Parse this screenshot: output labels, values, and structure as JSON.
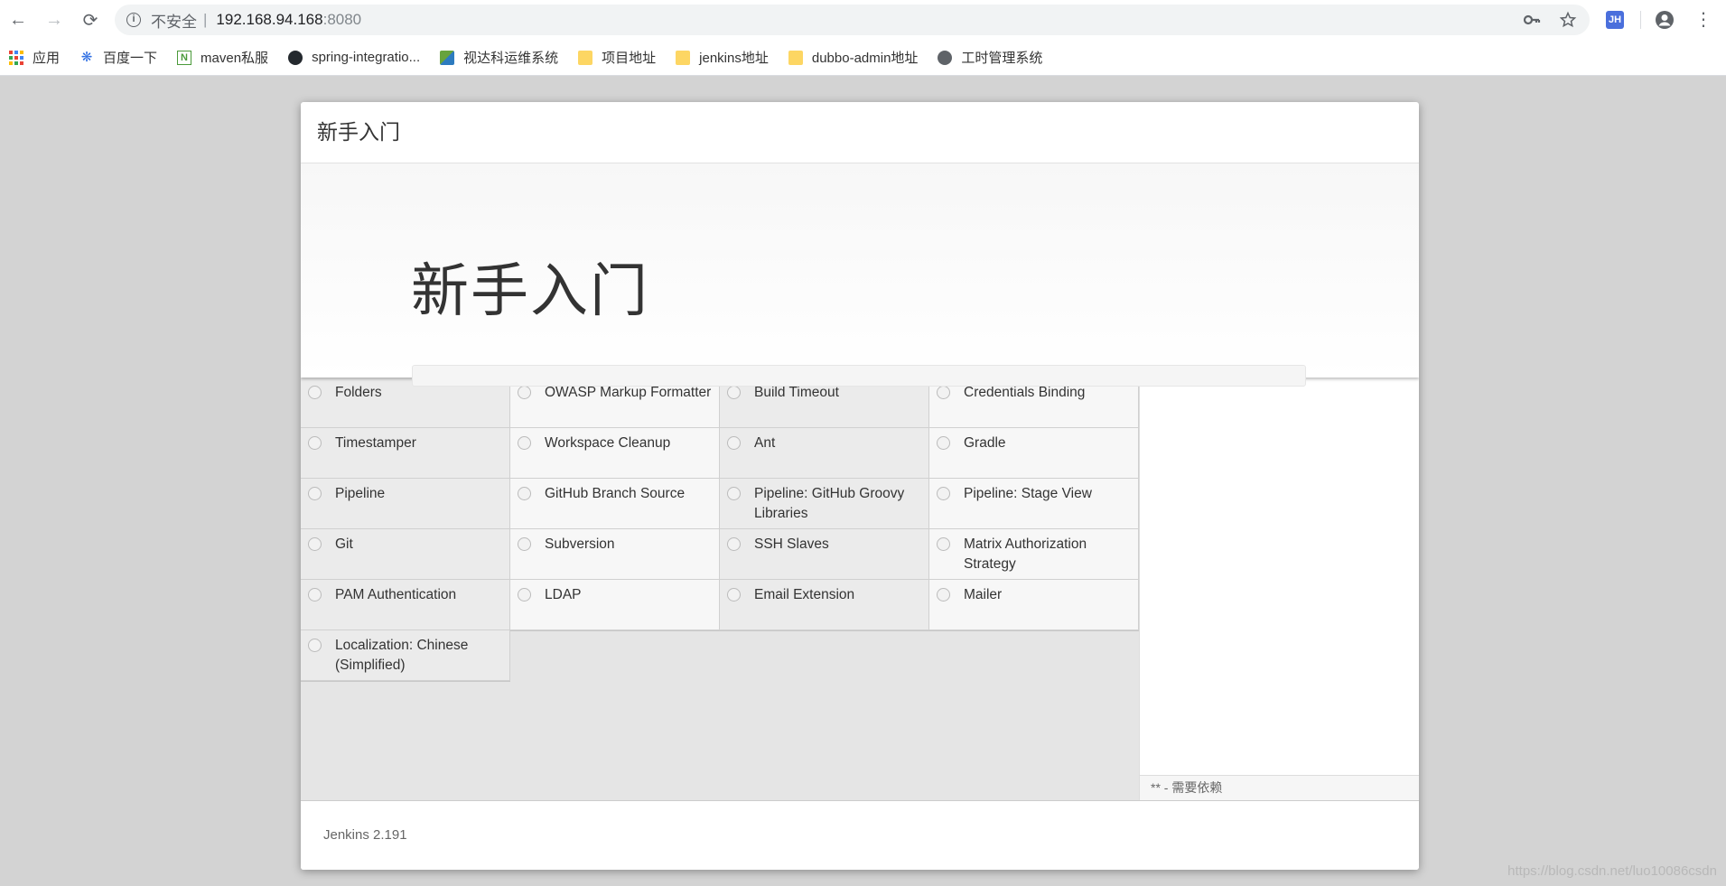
{
  "browser": {
    "nav": {
      "back": "←",
      "forward": "→",
      "reload": "⟳"
    },
    "omnibox": {
      "security_label": "不安全",
      "separator": "|",
      "host": "192.168.94.168",
      "port": ":8080"
    },
    "extension_label": "JH",
    "menu_glyph": "⋮"
  },
  "bookmarks": [
    {
      "label": "应用",
      "icon": "apps-icon"
    },
    {
      "label": "百度一下",
      "icon": "baidu-icon"
    },
    {
      "label": "maven私服",
      "icon": "nexus-icon"
    },
    {
      "label": "spring-integratio...",
      "icon": "github-icon"
    },
    {
      "label": "视达科运维系统",
      "icon": "vmware-icon"
    },
    {
      "label": "项目地址",
      "icon": "folder-icon"
    },
    {
      "label": "jenkins地址",
      "icon": "folder-icon"
    },
    {
      "label": "dubbo-admin地址",
      "icon": "folder-icon"
    },
    {
      "label": "工时管理系统",
      "icon": "globe-icon"
    }
  ],
  "dialog": {
    "header_title": "新手入门",
    "hero_title": "新手入门",
    "progress": 0,
    "plugins": [
      "Folders",
      "OWASP Markup Formatter",
      "Build Timeout",
      "Credentials Binding",
      "Timestamper",
      "Workspace Cleanup",
      "Ant",
      "Gradle",
      "Pipeline",
      "GitHub Branch Source",
      "Pipeline: GitHub Groovy Libraries",
      "Pipeline: Stage View",
      "Git",
      "Subversion",
      "SSH Slaves",
      "Matrix Authorization Strategy",
      "PAM Authentication",
      "LDAP",
      "Email Extension",
      "Mailer",
      "Localization: Chinese (Simplified)"
    ],
    "dependency_note": "** - 需要依赖",
    "version": "Jenkins 2.191"
  },
  "watermark": "https://blog.csdn.net/luo10086csdn"
}
